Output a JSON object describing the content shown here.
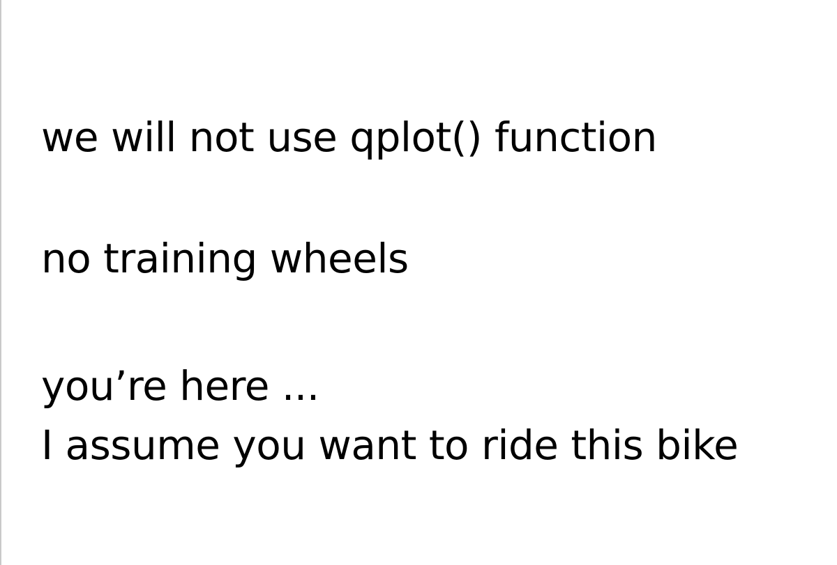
{
  "slide": {
    "lines": [
      "we will not use qplot() function",
      "no training wheels",
      "you’re here ...",
      "I assume you want to ride this bike"
    ]
  }
}
